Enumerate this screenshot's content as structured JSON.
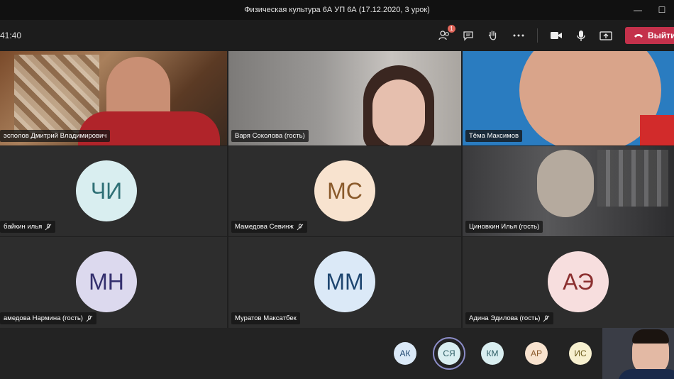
{
  "window": {
    "title": "Физическая культура 6А УП 6А (17.12.2020, 3 урок)"
  },
  "toolbar": {
    "timer": "41:40",
    "participants_badge": "1",
    "leave_label": "Выйти"
  },
  "tiles": [
    {
      "name": "Располов Дмитрий Владимирович",
      "display": "эсполов Дмитрий Владимирович"
    },
    {
      "name": "Варя Соколова (гость)"
    },
    {
      "name": "Тёма Максимов"
    },
    {
      "name": "Горбайкин илья",
      "display": "бaйкин илья",
      "initials": "ЧИ",
      "color": "#d9eef0",
      "text_color": "#2f7076"
    },
    {
      "name": "Мамедова Севинж",
      "initials": "МС",
      "color": "#f8e3cf",
      "text_color": "#8a5a2b"
    },
    {
      "name": "Циновкин Илья (гость)"
    },
    {
      "name": "Мамедова Нармина (гость)",
      "display": "амедова Нармина (гость)",
      "initials": "МН",
      "color": "#dcd9ee",
      "text_color": "#34306e"
    },
    {
      "name": "Муратов Максатбек",
      "initials": "ММ",
      "color": "#dbe9f7",
      "text_color": "#1e4670"
    },
    {
      "name": "Адина Эдилова (гость)",
      "initials": "АЭ",
      "color": "#f7dede",
      "text_color": "#8b2f2f"
    }
  ],
  "overflow": [
    {
      "initials": "АК",
      "color": "#dbe9f7",
      "text_color": "#1e4670"
    },
    {
      "initials": "СЯ",
      "color": "#d9eef0",
      "text_color": "#2f5f66"
    },
    {
      "initials": "КМ",
      "color": "#d9eef0",
      "text_color": "#2f5f66"
    },
    {
      "initials": "АР",
      "color": "#f8e3cf",
      "text_color": "#8a5a2b"
    },
    {
      "initials": "ИС",
      "color": "#f7f0cf",
      "text_color": "#6a5a1b"
    }
  ],
  "icons": [
    "participants-icon",
    "chat-icon",
    "raise-hand-icon",
    "more-icon",
    "camera-icon",
    "microphone-icon",
    "share-screen-icon",
    "hang-up-icon",
    "minimize-icon",
    "maximize-icon"
  ]
}
